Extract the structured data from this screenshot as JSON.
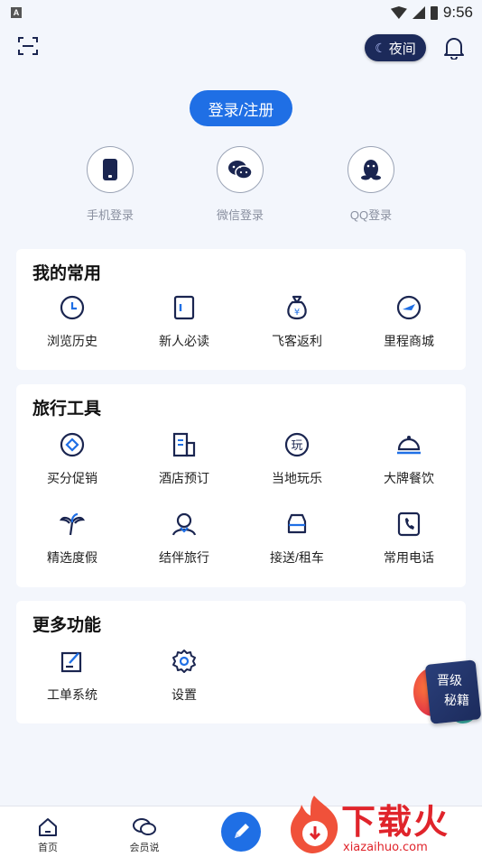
{
  "status_bar": {
    "time": "9:56"
  },
  "header": {
    "night_label": "夜间"
  },
  "login": {
    "button_label": "登录/注册",
    "options": [
      {
        "label": "手机登录",
        "icon": "phone-icon"
      },
      {
        "label": "微信登录",
        "icon": "wechat-icon"
      },
      {
        "label": "QQ登录",
        "icon": "qq-icon"
      }
    ]
  },
  "favorites": {
    "title": "我的常用",
    "items": [
      {
        "label": "浏览历史",
        "icon": "clock-icon"
      },
      {
        "label": "新人必读",
        "icon": "book-icon"
      },
      {
        "label": "飞客返利",
        "icon": "money-bag-icon"
      },
      {
        "label": "里程商城",
        "icon": "plane-icon"
      }
    ]
  },
  "travel_tools": {
    "title": "旅行工具",
    "items": [
      {
        "label": "买分促销",
        "icon": "diamond-icon"
      },
      {
        "label": "酒店预订",
        "icon": "building-icon"
      },
      {
        "label": "当地玩乐",
        "icon": "play-icon",
        "glyph": "玩"
      },
      {
        "label": "大牌餐饮",
        "icon": "dish-icon"
      },
      {
        "label": "精选度假",
        "icon": "palm-icon"
      },
      {
        "label": "结伴旅行",
        "icon": "companion-icon"
      },
      {
        "label": "接送/租车",
        "icon": "car-icon"
      },
      {
        "label": "常用电话",
        "icon": "phone-call-icon"
      }
    ]
  },
  "more": {
    "title": "更多功能",
    "items": [
      {
        "label": "工单系统",
        "icon": "edit-icon"
      },
      {
        "label": "设置",
        "icon": "gear-icon"
      }
    ]
  },
  "promo": {
    "line1": "晋级",
    "line2": "秘籍"
  },
  "bottom_nav": {
    "items": [
      {
        "label": "首页",
        "icon": "home-icon"
      },
      {
        "label": "会员说",
        "icon": "chat-icon"
      }
    ]
  },
  "watermark": {
    "brand": "下载火",
    "url": "xiazaihuo.com"
  },
  "colors": {
    "accent": "#1f6fe5",
    "night_bg": "#1c2a5a",
    "page_bg": "#f3f6fc"
  }
}
